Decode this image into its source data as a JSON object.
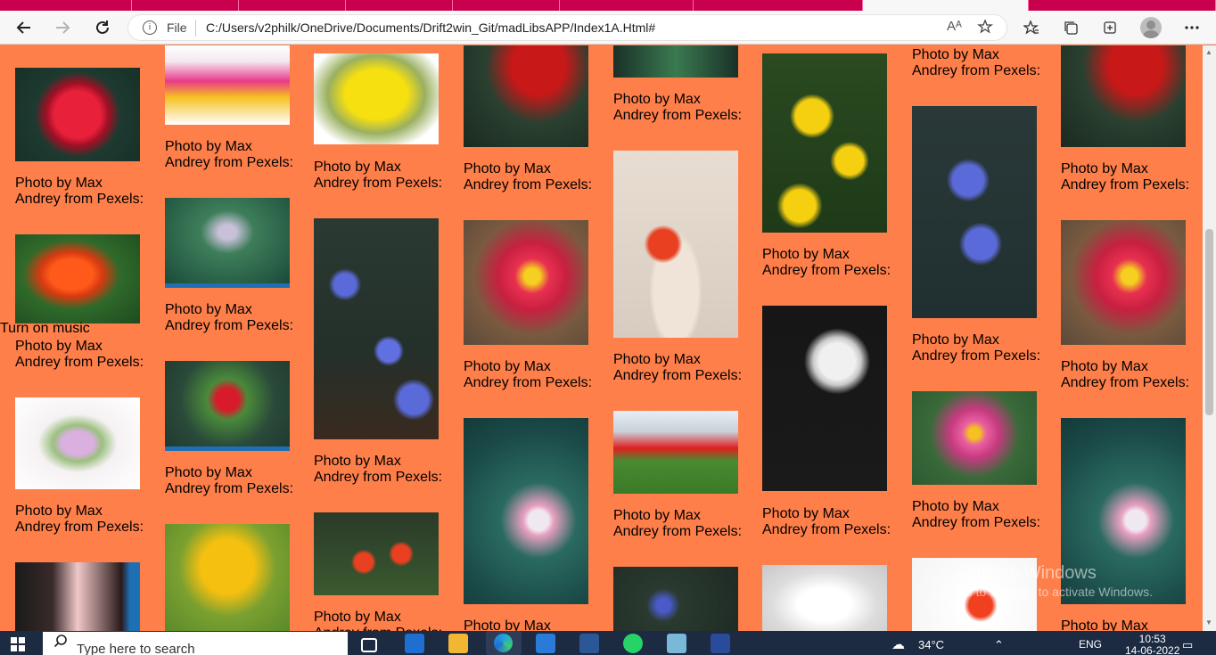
{
  "browser": {
    "address_scheme": "File",
    "url": "C:/Users/v2philk/OneDrive/Documents/Drift2win_Git/madLibsAPP/Index1A.Html#",
    "reader_label": "Aᴬ"
  },
  "page": {
    "caption_text": "Photo by Max Andrey from Pexels:",
    "music_label": "Turn on music",
    "watermark_title": "Activate Windows",
    "watermark_sub": "Go to Settings to activate Windows."
  },
  "taskbar": {
    "search_placeholder": "Type here to search",
    "weather": "34°C",
    "language": "ENG",
    "time": "10:53",
    "date": "14-06-2022"
  },
  "colors": {
    "page_background": "#ff7f4a",
    "tab_strip": "#c9004e",
    "taskbar": "#1c2a42"
  },
  "icons": [
    "back-arrow-icon",
    "forward-arrow-icon",
    "refresh-icon",
    "info-icon",
    "read-aloud-icon",
    "add-favorite-icon",
    "favorites-icon",
    "collections-icon",
    "extensions-icon",
    "more-icon",
    "windows-start-icon",
    "search-icon"
  ]
}
